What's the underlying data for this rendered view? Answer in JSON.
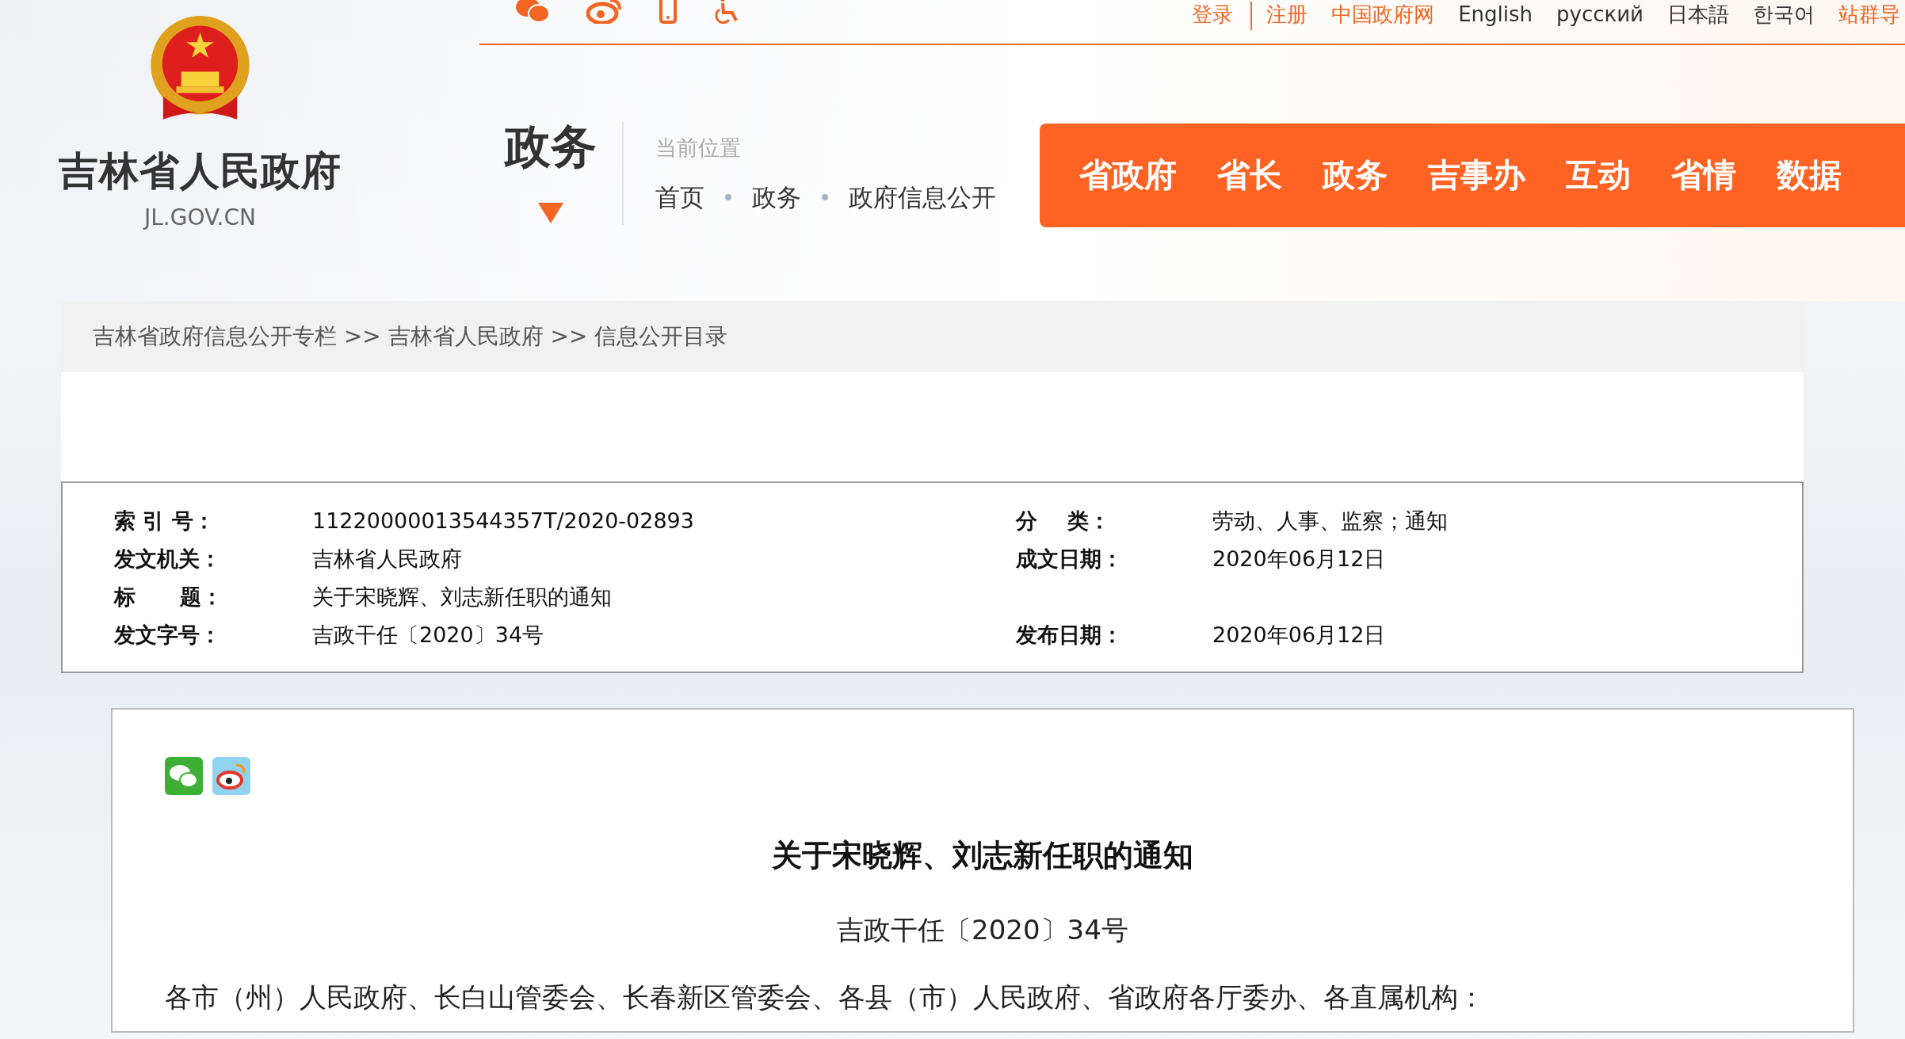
{
  "top_bar": {
    "links": [
      {
        "label": "登录",
        "highlighted": true
      },
      {
        "label": "注册",
        "highlighted": true
      },
      {
        "label": "中国政府网",
        "highlighted": true
      },
      {
        "label": "English",
        "highlighted": false
      },
      {
        "label": "русский",
        "highlighted": false
      },
      {
        "label": "日本語",
        "highlighted": false
      },
      {
        "label": "한국어",
        "highlighted": false
      },
      {
        "label": "站群导",
        "highlighted": true
      }
    ]
  },
  "logo": {
    "title": "吉林省人民政府",
    "domain": "JL.GOV.CN"
  },
  "section_title": "政务",
  "location": {
    "label": "当前位置",
    "crumbs": [
      "首页",
      "政务",
      "政府信息公开"
    ]
  },
  "nav": [
    {
      "label": "省政府"
    },
    {
      "label": "省长"
    },
    {
      "label": "政务"
    },
    {
      "label": "吉事办"
    },
    {
      "label": "互动"
    },
    {
      "label": "省情"
    },
    {
      "label": "数据"
    }
  ],
  "breadcrumb": "吉林省政府信息公开专栏 >> 吉林省人民政府 >> 信息公开目录",
  "meta": [
    {
      "cells": [
        {
          "label": "索 引 号：",
          "value": "11220000013544357T/2020-02893"
        },
        {
          "label": "分    类：",
          "value": "劳动、人事、监察；通知"
        }
      ]
    },
    {
      "cells": [
        {
          "label": "发文机关：",
          "value": "吉林省人民政府"
        },
        {
          "label": "成文日期：",
          "value": "2020年06月12日"
        }
      ]
    },
    {
      "cells": [
        {
          "label": "标      题：",
          "value": "关于宋晓辉、刘志新任职的通知"
        }
      ]
    },
    {
      "cells": [
        {
          "label": "发文字号：",
          "value": "吉政干任〔2020〕34号"
        },
        {
          "label": "发布日期：",
          "value": "2020年06月12日"
        }
      ]
    }
  ],
  "article": {
    "title": "关于宋晓辉、刘志新任职的通知",
    "doc_number": "吉政干任〔2020〕34号",
    "paragraphs": [
      "各市（州）人民政府、长白山管委会、长春新区管委会、各县（市）人民政府、省政府各厅委办、各直属机构："
    ]
  }
}
